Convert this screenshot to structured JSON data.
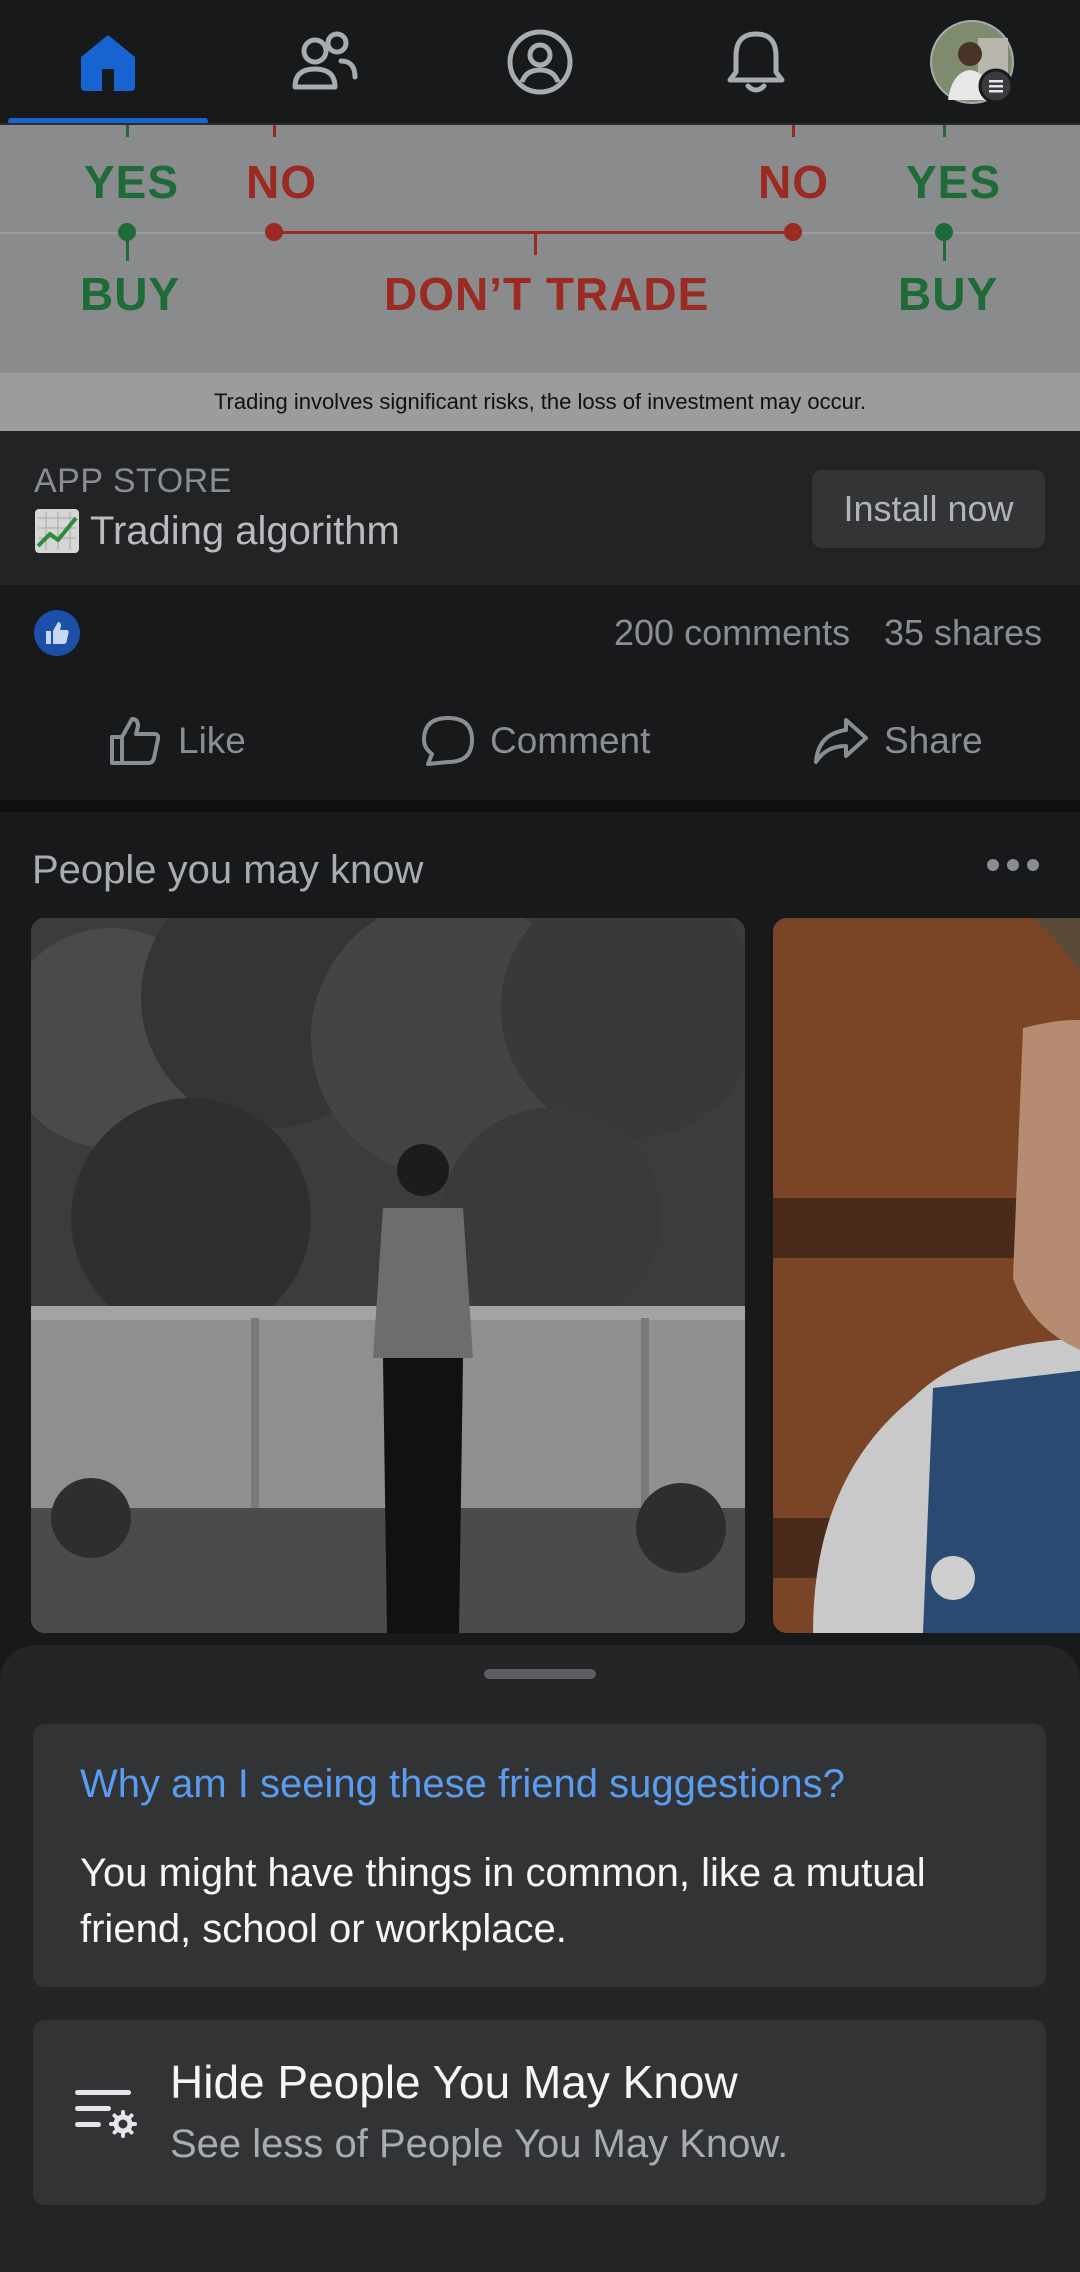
{
  "nav": {
    "tabs": [
      {
        "icon": "home-icon",
        "active": true
      },
      {
        "icon": "friends-icon",
        "active": false
      },
      {
        "icon": "profile-icon",
        "active": false
      },
      {
        "icon": "bell-icon",
        "active": false
      },
      {
        "icon": "avatar-menu-icon",
        "active": false
      }
    ],
    "accent": "#1763cf"
  },
  "ad": {
    "graphic": {
      "yes_left": "YES",
      "no_left": "NO",
      "no_right": "NO",
      "yes_right": "YES",
      "buy_left": "BUY",
      "dont_trade": "DON’T TRADE",
      "buy_right": "BUY"
    },
    "disclaimer": "Trading involves significant risks, the loss of investment may occur.",
    "source_label": "APP STORE",
    "title": "Trading algorithm",
    "title_icon": "chart-increasing-icon",
    "cta": "Install now"
  },
  "reactions": {
    "icon": "like-badge-icon",
    "comments": "200 comments",
    "shares": "35 shares"
  },
  "actions": {
    "like": "Like",
    "comment": "Comment",
    "share": "Share"
  },
  "pymk": {
    "title": "People you may know",
    "more_icon": "more-dots-icon"
  },
  "sheet": {
    "question": "Why am I seeing these friend suggestions?",
    "answer": "You might have things in common, like a mutual friend, school or workplace.",
    "hide_title": "Hide People You May Know",
    "hide_subtitle": "See less of People You May Know.",
    "hide_icon": "filter-settings-icon"
  },
  "colors": {
    "link": "#5a9cf0",
    "green": "#1f6b37",
    "red": "#9b2a22"
  }
}
